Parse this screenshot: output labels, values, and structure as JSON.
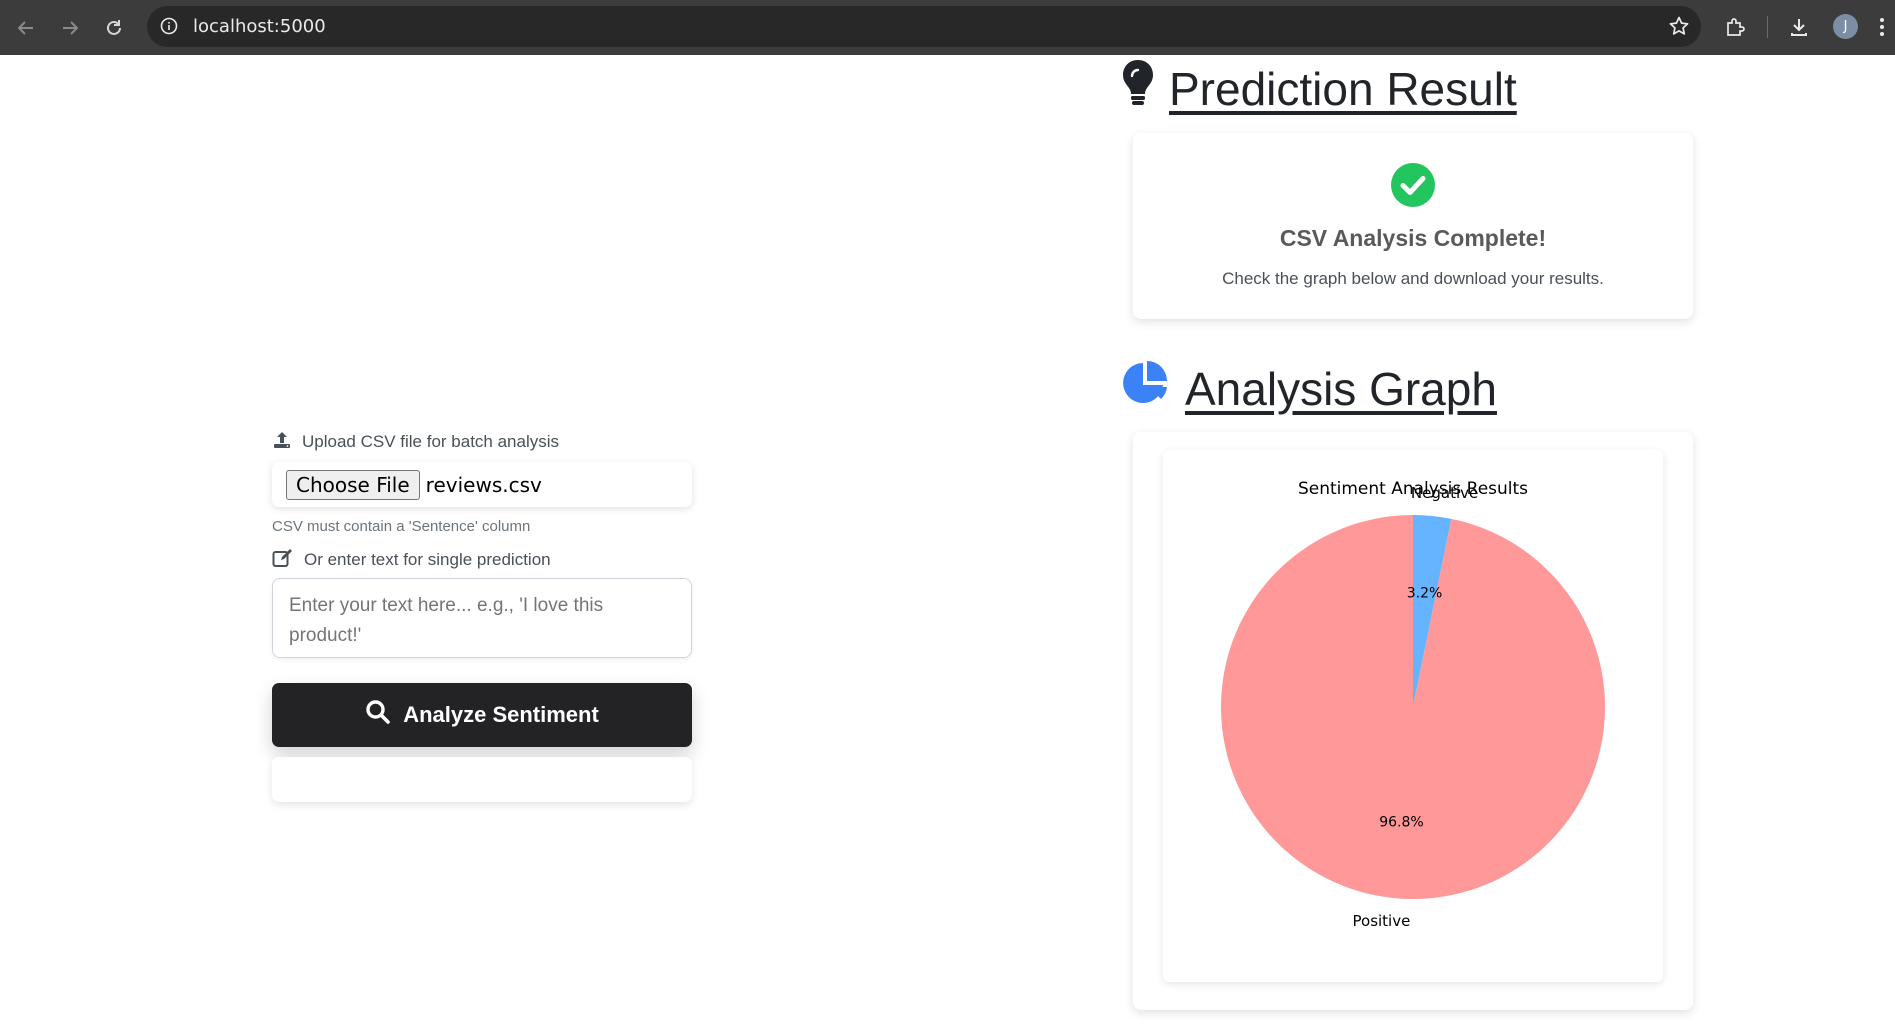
{
  "browser": {
    "url": "localhost:5000",
    "profile_initial": "J",
    "icons": [
      "back-icon",
      "forward-icon",
      "reload-icon",
      "site-info-icon",
      "bookmark-star-icon",
      "extensions-icon",
      "download-icon",
      "kebab-menu-icon"
    ]
  },
  "form": {
    "upload_label": "Upload CSV file for batch analysis",
    "choose_file_label": "Choose File",
    "file_name": "reviews.csv",
    "csv_help": "CSV must contain a 'Sentence' column",
    "text_label": "Or enter text for single prediction",
    "text_placeholder": "Enter your text here... e.g., 'I love this product!'",
    "analyze_label": "Analyze Sentiment"
  },
  "result": {
    "title": "Prediction Result",
    "heading": "CSV Analysis Complete!",
    "message": "Check the graph below and download your results."
  },
  "graph": {
    "title": "Analysis Graph"
  },
  "colors": {
    "negative": "#66b3ff",
    "positive": "#ff9999",
    "success": "#22c55e",
    "chart_icon": "#3b82f6",
    "button": "#232326"
  },
  "chart_data": {
    "type": "pie",
    "title": "Sentiment Analysis Results",
    "labels": [
      "Negative",
      "Positive"
    ],
    "values": [
      3.2,
      96.8
    ],
    "value_labels": [
      "3.2%",
      "96.8%"
    ],
    "colors": [
      "#66b3ff",
      "#ff9999"
    ]
  }
}
